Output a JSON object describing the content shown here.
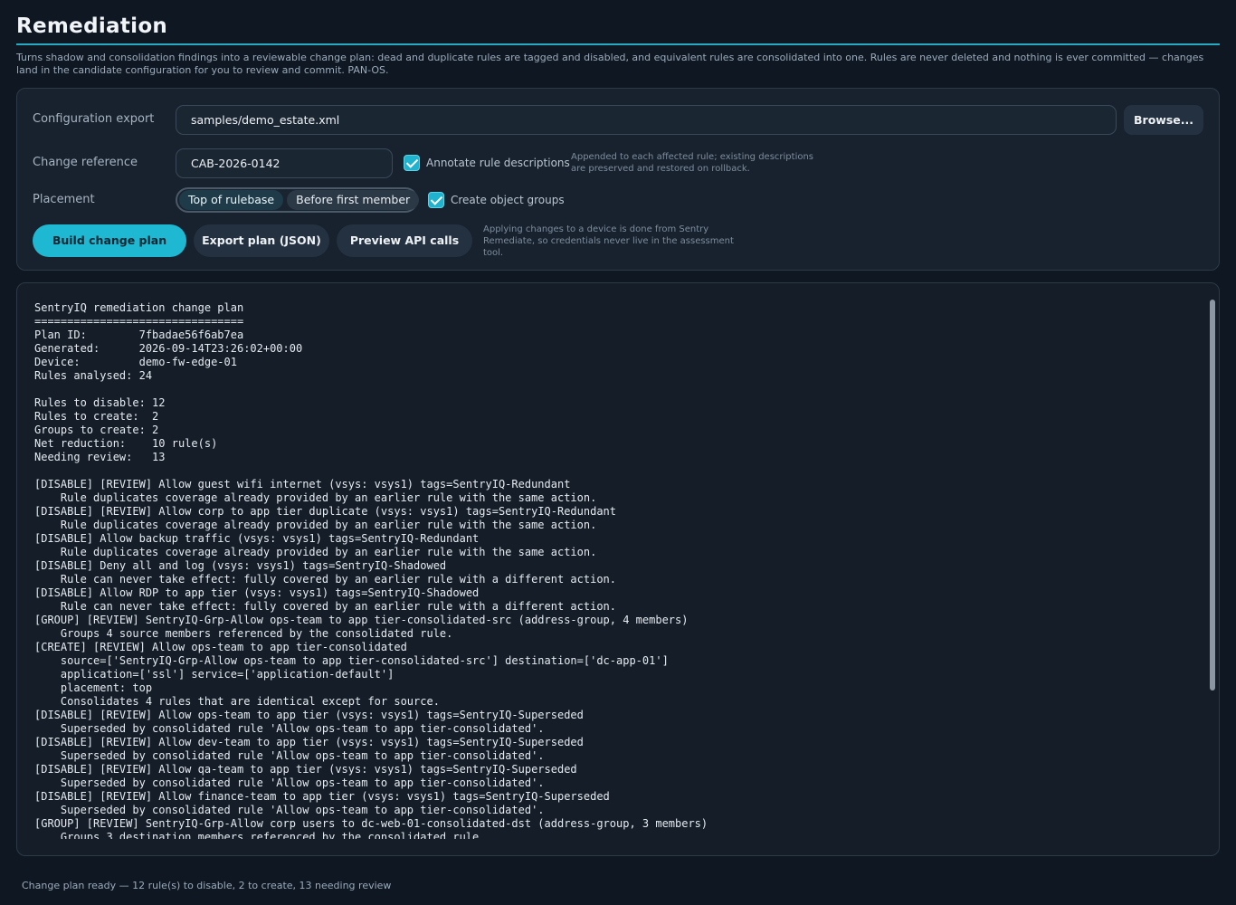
{
  "page": {
    "title": "Remediation",
    "intro": "Turns shadow and consolidation findings into a reviewable change plan: dead and duplicate rules are tagged and disabled, and equivalent rules are consolidated into one. Rules are never deleted and nothing is ever committed — changes land in the candidate configuration for you to review and commit. PAN-OS."
  },
  "form": {
    "config_label": "Configuration export",
    "config_value": "samples/demo_estate.xml",
    "browse_label": "Browse...",
    "change_ref_label": "Change reference",
    "change_ref_value": "CAB-2026-0142",
    "annotate_label": "Annotate rule descriptions",
    "annotate_checked": true,
    "annotate_hint": "Appended to each affected rule; existing descriptions are preserved and restored on rollback.",
    "placement_label": "Placement",
    "placement_options": [
      "Top of rulebase",
      "Before first member"
    ],
    "placement_selected": "Top of rulebase",
    "groups_label": "Create object groups",
    "groups_checked": true,
    "build_label": "Build change plan",
    "export_label": "Export plan (JSON)",
    "preview_label": "Preview API calls",
    "apply_hint": "Applying changes to a device is done from Sentry Remediate, so credentials never live in the assessment tool."
  },
  "output": {
    "text": "SentryIQ remediation change plan\n================================\nPlan ID:        7fbadae56f6ab7ea\nGenerated:      2026-09-14T23:26:02+00:00\nDevice:         demo-fw-edge-01\nRules analysed: 24\n\nRules to disable: 12\nRules to create:  2\nGroups to create: 2\nNet reduction:    10 rule(s)\nNeeding review:   13\n\n[DISABLE] [REVIEW] Allow guest wifi internet (vsys: vsys1) tags=SentryIQ-Redundant\n    Rule duplicates coverage already provided by an earlier rule with the same action.\n[DISABLE] [REVIEW] Allow corp to app tier duplicate (vsys: vsys1) tags=SentryIQ-Redundant\n    Rule duplicates coverage already provided by an earlier rule with the same action.\n[DISABLE] Allow backup traffic (vsys: vsys1) tags=SentryIQ-Redundant\n    Rule duplicates coverage already provided by an earlier rule with the same action.\n[DISABLE] Deny all and log (vsys: vsys1) tags=SentryIQ-Shadowed\n    Rule can never take effect: fully covered by an earlier rule with a different action.\n[DISABLE] Allow RDP to app tier (vsys: vsys1) tags=SentryIQ-Shadowed\n    Rule can never take effect: fully covered by an earlier rule with a different action.\n[GROUP] [REVIEW] SentryIQ-Grp-Allow ops-team to app tier-consolidated-src (address-group, 4 members)\n    Groups 4 source members referenced by the consolidated rule.\n[CREATE] [REVIEW] Allow ops-team to app tier-consolidated\n    source=['SentryIQ-Grp-Allow ops-team to app tier-consolidated-src'] destination=['dc-app-01']\n    application=['ssl'] service=['application-default']\n    placement: top\n    Consolidates 4 rules that are identical except for source.\n[DISABLE] [REVIEW] Allow ops-team to app tier (vsys: vsys1) tags=SentryIQ-Superseded\n    Superseded by consolidated rule 'Allow ops-team to app tier-consolidated'.\n[DISABLE] [REVIEW] Allow dev-team to app tier (vsys: vsys1) tags=SentryIQ-Superseded\n    Superseded by consolidated rule 'Allow ops-team to app tier-consolidated'.\n[DISABLE] [REVIEW] Allow qa-team to app tier (vsys: vsys1) tags=SentryIQ-Superseded\n    Superseded by consolidated rule 'Allow ops-team to app tier-consolidated'.\n[DISABLE] [REVIEW] Allow finance-team to app tier (vsys: vsys1) tags=SentryIQ-Superseded\n    Superseded by consolidated rule 'Allow ops-team to app tier-consolidated'.\n[GROUP] [REVIEW] SentryIQ-Grp-Allow corp users to dc-web-01-consolidated-dst (address-group, 3 members)\n    Groups 3 destination members referenced by the consolidated rule."
  },
  "status": {
    "text": "Change plan ready — 12 rule(s) to disable, 2 to create, 13 needing review"
  },
  "colors": {
    "accent": "#1fb8d2",
    "background": "#0f1722",
    "panel": "#18222e"
  }
}
